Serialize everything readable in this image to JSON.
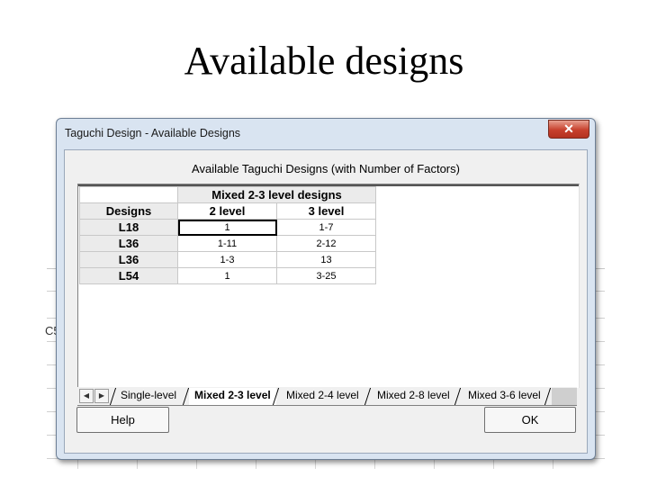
{
  "slide": {
    "title": "Available designs"
  },
  "background": {
    "partial_cell_label": "C5"
  },
  "dialog": {
    "title": "Taguchi Design - Available Designs",
    "close_glyph": "✕",
    "heading": "Available Taguchi Designs (with Number of Factors)",
    "table": {
      "group_header": "Mixed 2-3 level designs",
      "designs_header": "Designs",
      "col_2_header": "2 level",
      "col_3_header": "3 level",
      "rows": [
        {
          "design": "L18",
          "two": "1",
          "three": "1-7"
        },
        {
          "design": "L36",
          "two": "1-11",
          "three": "2-12"
        },
        {
          "design": "L36",
          "two": "1-3",
          "three": "13"
        },
        {
          "design": "L54",
          "two": "1",
          "three": "3-25"
        }
      ]
    },
    "tabs": [
      {
        "label": "Single-level",
        "active": false
      },
      {
        "label": "Mixed 2-3 level",
        "active": true
      },
      {
        "label": "Mixed 2-4 level",
        "active": false
      },
      {
        "label": "Mixed 2-8 level",
        "active": false
      },
      {
        "label": "Mixed 3-6 level",
        "active": false
      }
    ],
    "nav": {
      "prev_glyph": "◀",
      "next_glyph": "▶"
    },
    "buttons": {
      "help": "Help",
      "ok": "OK"
    }
  }
}
